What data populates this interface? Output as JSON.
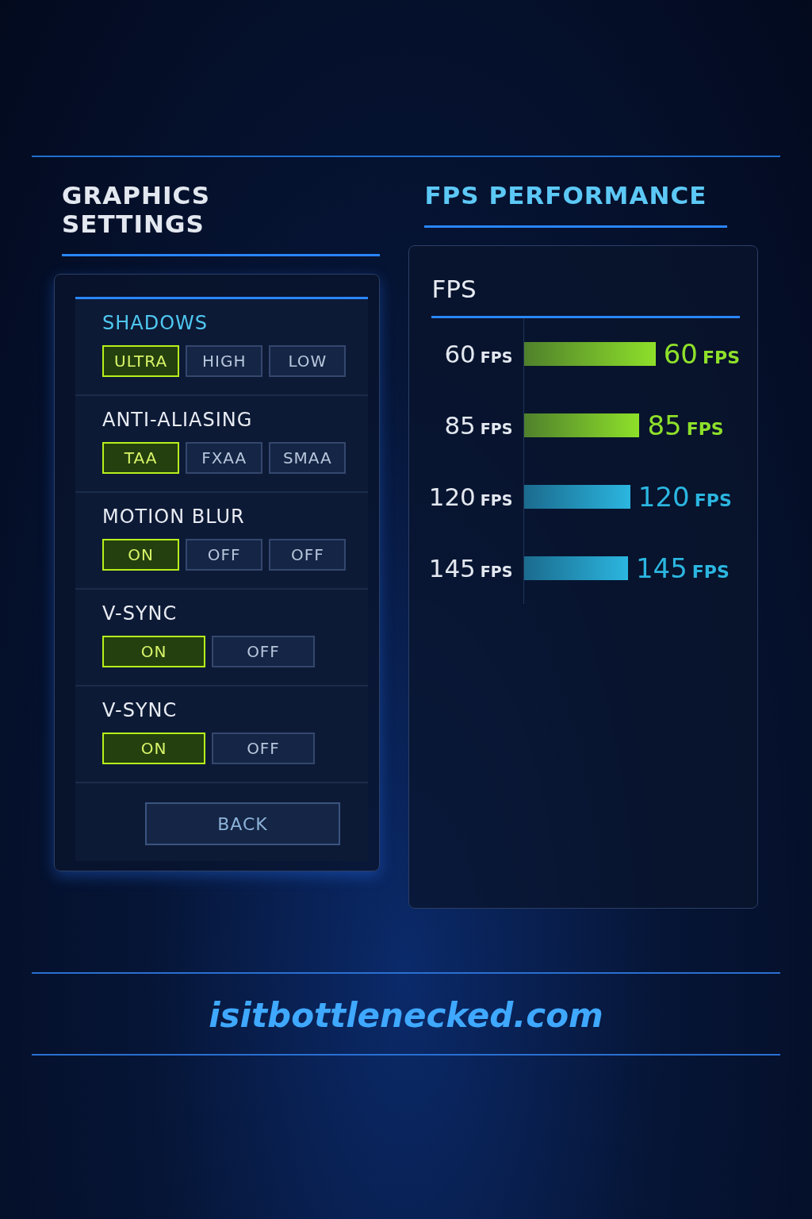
{
  "graphics": {
    "title": "GRAPHICS SETTINGS",
    "sections": [
      {
        "label": "SHADOWS",
        "highlighted": true,
        "options": [
          {
            "label": "ULTRA",
            "selected": true
          },
          {
            "label": "HIGH",
            "selected": false
          },
          {
            "label": "LOW",
            "selected": false
          }
        ]
      },
      {
        "label": "ANTI-ALIASING",
        "highlighted": false,
        "options": [
          {
            "label": "TAA",
            "selected": true
          },
          {
            "label": "FXAA",
            "selected": false
          },
          {
            "label": "SMAA",
            "selected": false
          }
        ]
      },
      {
        "label": "MOTION BLUR",
        "highlighted": false,
        "options": [
          {
            "label": "ON",
            "selected": true
          },
          {
            "label": "OFF",
            "selected": false
          },
          {
            "label": "OFF",
            "selected": false
          }
        ]
      },
      {
        "label": "V-SYNC",
        "highlighted": false,
        "options": [
          {
            "label": "ON",
            "selected": true
          },
          {
            "label": "OFF",
            "selected": false
          }
        ]
      },
      {
        "label": "V-SYNC",
        "highlighted": false,
        "options": [
          {
            "label": "ON",
            "selected": true
          },
          {
            "label": "OFF",
            "selected": false
          }
        ]
      }
    ],
    "back_button": "BACK"
  },
  "performance": {
    "title": "FPS PERFORMANCE",
    "panel_title": "FPS",
    "rows": [
      {
        "value": "60",
        "unit": "FPS",
        "level": 0.57,
        "color": "#8ee02a",
        "bar_value": "60",
        "bar_unit": "FPS"
      },
      {
        "value": "85",
        "unit": "FPS",
        "level": 0.5,
        "color": "#8ee02a",
        "bar_value": "85",
        "bar_unit": "FPS"
      },
      {
        "value": "120",
        "unit": "FPS",
        "level": 0.46,
        "color": "#2bb6e0",
        "bar_value": "120",
        "bar_unit": "FPS"
      },
      {
        "value": "145",
        "unit": "FPS",
        "level": 0.45,
        "color": "#2bb6e0",
        "bar_value": "145",
        "bar_unit": "FPS"
      }
    ]
  },
  "footer": {
    "site": "isitbottlenecked.com"
  }
}
